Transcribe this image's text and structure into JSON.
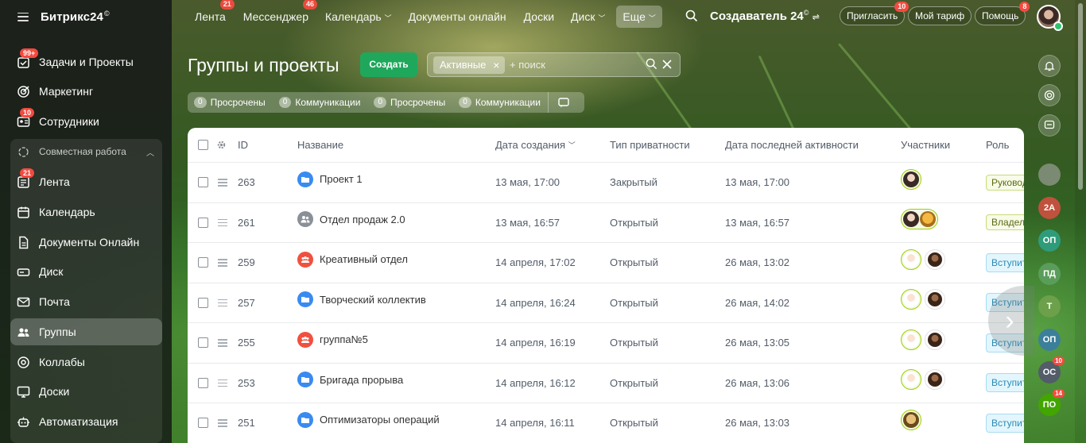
{
  "app": {
    "logo": "Битрикс24",
    "logo_mark": "©"
  },
  "topnav": {
    "items": [
      {
        "label": "Лента",
        "badge": "21"
      },
      {
        "label": "Мессенджер",
        "badge": "46"
      },
      {
        "label": "Календарь",
        "badge": ""
      },
      {
        "label": "Документы онлайн",
        "badge": ""
      },
      {
        "label": "Доски",
        "badge": ""
      },
      {
        "label": "Диск",
        "badge": ""
      }
    ],
    "more_label": "Еще",
    "company": "Создаватель 24",
    "company_mark": "©",
    "invite_label": "Пригласить",
    "invite_badge": "10",
    "tariff_label": "Мой тариф",
    "help_label": "Помощь",
    "help_badge": "8"
  },
  "sidebar": {
    "items": [
      {
        "label": "Задачи и Проекты",
        "badge": "99+"
      },
      {
        "label": "Маркетинг",
        "badge": ""
      },
      {
        "label": "Сотрудники",
        "badge": "10"
      }
    ],
    "group_label": "Совместная работа",
    "group_items": [
      {
        "label": "Лента",
        "badge": "21"
      },
      {
        "label": "Календарь",
        "badge": ""
      },
      {
        "label": "Документы Онлайн",
        "badge": ""
      },
      {
        "label": "Диск",
        "badge": ""
      },
      {
        "label": "Почта",
        "badge": ""
      },
      {
        "label": "Группы",
        "badge": ""
      },
      {
        "label": "Коллабы",
        "badge": ""
      },
      {
        "label": "Доски",
        "badge": ""
      }
    ],
    "bottom_item": {
      "label": "Автоматизация"
    }
  },
  "page": {
    "title": "Группы и проекты",
    "create_label": "Создать",
    "filter_chip": "Активные",
    "search_placeholder": "+ поиск"
  },
  "counters": [
    {
      "count": "0",
      "label": "Просрочены"
    },
    {
      "count": "0",
      "label": "Коммуникации"
    },
    {
      "count": "0",
      "label": "Просрочены"
    },
    {
      "count": "0",
      "label": "Коммуникации"
    }
  ],
  "table": {
    "columns": {
      "id": "ID",
      "name": "Название",
      "created": "Дата создания",
      "privacy": "Тип приватности",
      "activity": "Дата последней активности",
      "members": "Участники",
      "role": "Роль"
    },
    "rows": [
      {
        "id": "263",
        "name": "Проект 1",
        "icon": "folder-icon",
        "created": "13 мая, 17:00",
        "privacy": "Закрытый",
        "activity": "13 мая, 17:00",
        "role": "Руковод",
        "role_kind": "lead"
      },
      {
        "id": "261",
        "name": "Отдел продаж 2.0",
        "icon": "group-icon",
        "created": "13 мая, 16:57",
        "privacy": "Открытый",
        "activity": "13 мая, 16:57",
        "role": "Владеле",
        "role_kind": "lead"
      },
      {
        "id": "259",
        "name": "Креативный отдел",
        "icon": "group-red-icon",
        "created": "14 апреля, 17:02",
        "privacy": "Открытый",
        "activity": "26 мая, 13:02",
        "role": "Вступит",
        "role_kind": "join"
      },
      {
        "id": "257",
        "name": "Творческий коллектив",
        "icon": "folder-icon",
        "created": "14 апреля, 16:24",
        "privacy": "Открытый",
        "activity": "26 мая, 14:02",
        "role": "Вступит",
        "role_kind": "join"
      },
      {
        "id": "255",
        "name": "группа№5",
        "icon": "group-red-icon",
        "created": "14 апреля, 16:19",
        "privacy": "Открытый",
        "activity": "26 мая, 13:05",
        "role": "Вступит",
        "role_kind": "join"
      },
      {
        "id": "253",
        "name": "Бригада прорыва",
        "icon": "folder-icon",
        "created": "14 апреля, 16:12",
        "privacy": "Открытый",
        "activity": "26 мая, 13:06",
        "role": "Вступит",
        "role_kind": "join"
      },
      {
        "id": "251",
        "name": "Оптимизаторы операций",
        "icon": "folder-icon",
        "created": "14 апреля, 16:11",
        "privacy": "Открытый",
        "activity": "26 мая, 13:03",
        "role": "Вступит",
        "role_kind": "join"
      }
    ]
  },
  "right_rail": [
    {
      "label": "2А",
      "color": "#c0513d"
    },
    {
      "label": "ОП",
      "color": "#2e9c7a"
    },
    {
      "label": "ПД",
      "color": "#5a9c5a"
    },
    {
      "label": "Т",
      "color": "#6ca04a"
    },
    {
      "label": "ОП",
      "color": "#3c7f9a"
    },
    {
      "label": "ОС",
      "color": "#535c69",
      "badge": "10"
    },
    {
      "label": "ПО",
      "color": "#43a600",
      "badge": "14"
    }
  ],
  "colors": {
    "accent_green": "#1fa85c",
    "badge_red": "#f54a3f",
    "member_border": "#9dcf00"
  }
}
